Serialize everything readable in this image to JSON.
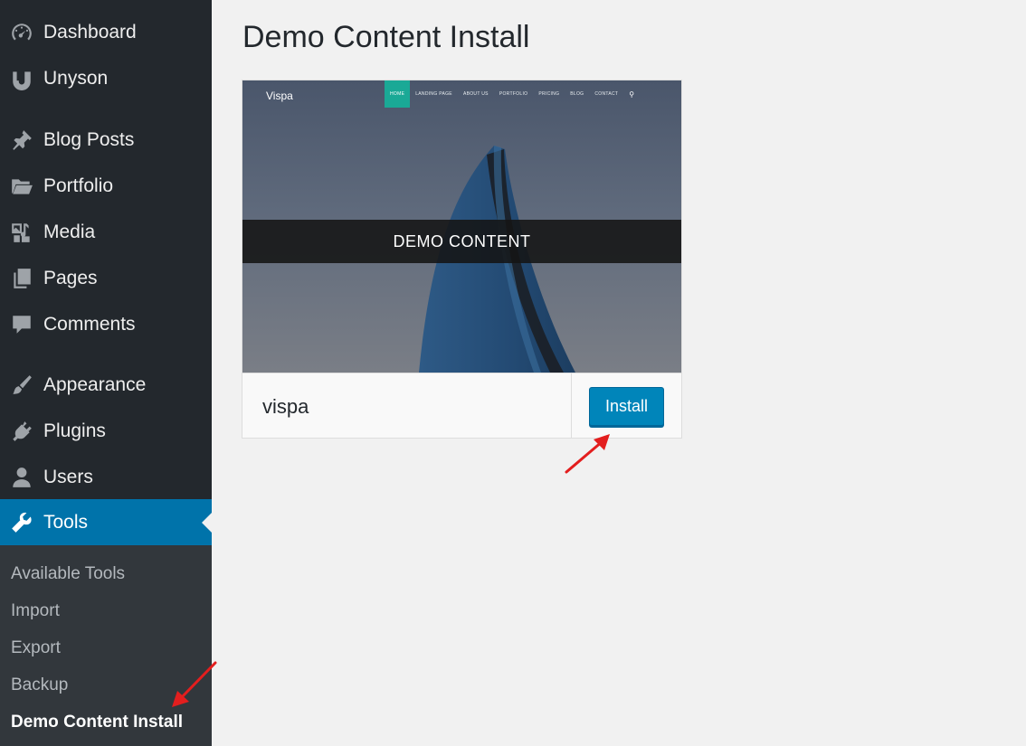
{
  "sidebar": {
    "items": [
      {
        "label": "Dashboard",
        "icon": "dashboard-icon"
      },
      {
        "label": "Unyson",
        "icon": "unyson-icon"
      },
      {
        "label": "Blog Posts",
        "icon": "pin-icon"
      },
      {
        "label": "Portfolio",
        "icon": "folder-icon"
      },
      {
        "label": "Media",
        "icon": "media-icon"
      },
      {
        "label": "Pages",
        "icon": "pages-icon"
      },
      {
        "label": "Comments",
        "icon": "comment-icon"
      },
      {
        "label": "Appearance",
        "icon": "brush-icon"
      },
      {
        "label": "Plugins",
        "icon": "plugin-icon"
      },
      {
        "label": "Users",
        "icon": "user-icon"
      },
      {
        "label": "Tools",
        "icon": "wrench-icon"
      }
    ],
    "submenu": [
      {
        "label": "Available Tools"
      },
      {
        "label": "Import"
      },
      {
        "label": "Export"
      },
      {
        "label": "Backup"
      },
      {
        "label": "Demo Content Install"
      }
    ]
  },
  "main": {
    "title": "Demo Content Install",
    "demo": {
      "theme_name": "vispa",
      "install_label": "Install",
      "preview": {
        "site_logo": "Vispa",
        "nav": [
          "HOME",
          "LANDING PAGE",
          "ABOUT US",
          "PORTFOLIO",
          "PRICING",
          "BLOG",
          "CONTACT"
        ],
        "search_icon": "search-icon",
        "band_text": "DEMO CONTENT"
      }
    }
  },
  "colors": {
    "sidebar_bg": "#23282d",
    "submenu_bg": "#32373c",
    "active_bg": "#0073aa",
    "button_bg": "#0085ba",
    "nav_active": "#1aa996",
    "annotation": "#e31e1e"
  }
}
